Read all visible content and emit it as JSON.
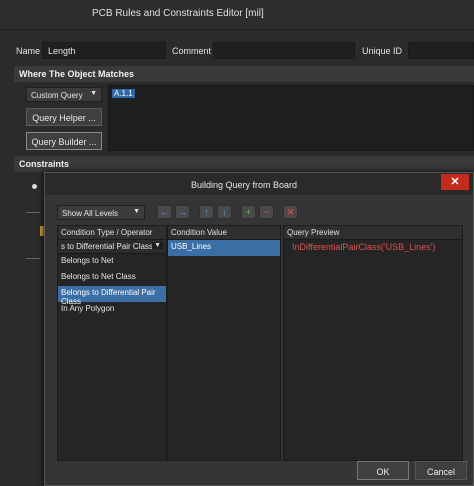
{
  "window": {
    "title": "PCB Rules and Constraints Editor [mil]"
  },
  "form": {
    "name_label": "Name",
    "name_value": "Length",
    "comment_label": "Comment",
    "comment_value": "",
    "uniqueid_label": "Unique ID",
    "uniqueid_value": ""
  },
  "where": {
    "title": "Where The Object Matches",
    "query_dropdown": "Custom Query",
    "query_text": "A.1.1",
    "query_helper": "Query Helper ...",
    "query_builder": "Query Builder ..."
  },
  "constraints": {
    "title": "Constraints"
  },
  "dialog": {
    "title": "Building Query from Board",
    "close": "✕",
    "levels": "Show All Levels",
    "col_condition": "Condition Type / Operator",
    "col_value": "Condition Value",
    "col_preview": "Query Preview",
    "current_condition": "s to Differential Pair Class",
    "current_value": "USB_Lines",
    "options": [
      "Belongs to Net",
      "Belongs to Net Class",
      "Belongs to Differential Pair Class",
      "In Any Polygon"
    ],
    "preview_text": "InDifferentialPairClass('USB_Lines')",
    "ok": "OK",
    "cancel": "Cancel"
  },
  "colors": {
    "accent": "#2e6aa8",
    "preview": "#e05050",
    "close": "#c42b1c"
  }
}
